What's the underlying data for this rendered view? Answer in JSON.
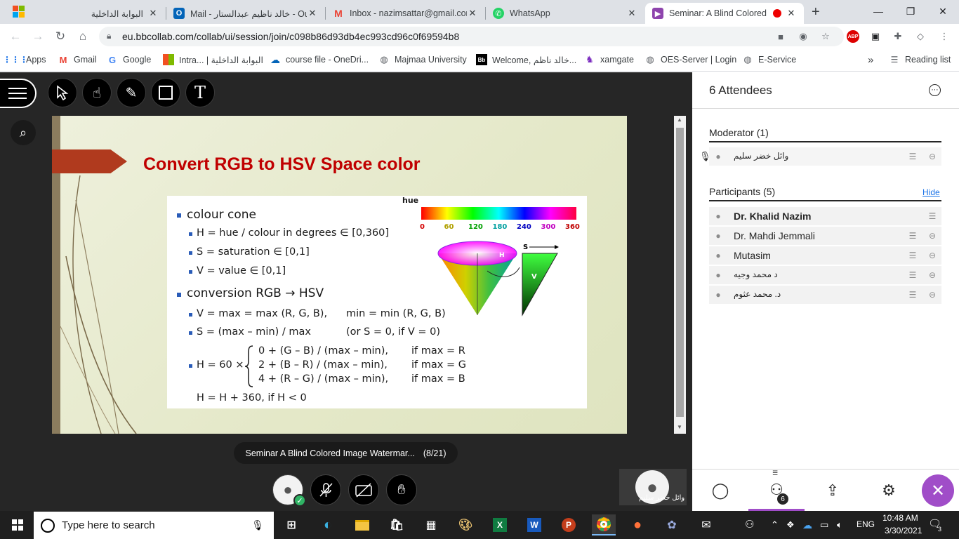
{
  "browser": {
    "tabs": [
      {
        "title": "البوابة الداخلية",
        "icon": "microsoft-icon"
      },
      {
        "title": "Mail - خالد ناظيم عبدالستار - Ou",
        "icon": "outlook-icon"
      },
      {
        "title": "Inbox - nazimsattar@gmail.com",
        "icon": "gmail-icon"
      },
      {
        "title": "WhatsApp",
        "icon": "whatsapp-icon"
      },
      {
        "title": "Seminar: A Blind Colored I",
        "icon": "collab-icon"
      }
    ],
    "url": "eu.bbcollab.com/collab/ui/session/join/c098b86d93db4ec993cd96c0f69594b8",
    "bookmarks": [
      {
        "label": "Apps",
        "icon": "apps-icon"
      },
      {
        "label": "Gmail",
        "icon": "gmail-icon"
      },
      {
        "label": "Google",
        "icon": "google-icon"
      },
      {
        "label": "Intra... | البوابة الداخلية",
        "icon": "microsoft-icon"
      },
      {
        "label": "course file - OneDri...",
        "icon": "onedrive-icon"
      },
      {
        "label": "Majmaa University",
        "icon": "globe-icon"
      },
      {
        "label": "Welcome, خالد ناظم...",
        "icon": "blackboard-icon"
      },
      {
        "label": "xamgate",
        "icon": "xamgate-icon"
      },
      {
        "label": "OES-Server | Login",
        "icon": "globe-icon"
      },
      {
        "label": "E-Service",
        "icon": "globe-icon"
      }
    ],
    "reading_list": "Reading list",
    "more_bookmarks": "»",
    "abp_label": "ABP"
  },
  "slide": {
    "title": "Convert RGB to HSV Space color",
    "hue_label": "hue",
    "hue_ticks": [
      "0",
      "60",
      "120",
      "180",
      "240",
      "300",
      "360"
    ],
    "hue_tick_colors": [
      "#d40000",
      "#b0a000",
      "#00a000",
      "#00a0a0",
      "#0000c0",
      "#c000c0",
      "#c00000"
    ],
    "cone_labels": {
      "h": "H",
      "s": "S",
      "v": "V"
    },
    "bullets": {
      "cone": "colour cone",
      "h": "H = hue / colour in degrees ∈ [0,360]",
      "s": "S = saturation ∈ [0,1]",
      "v": "V = value ∈ [0,1]",
      "conversion": "conversion RGB → HSV",
      "vmax": "V = max = max (R, G, B),",
      "vmin": "min = min (R, G, B)",
      "smax": "S = (max – min) / max",
      "sor": "(or  S = 0,  if  V = 0)",
      "hpre": "H = 60 ×",
      "hcase1": "0 + (G – B) / (max – min),",
      "hcase2": "2 + (B – R) / (max – min),",
      "hcase3": "4 + (R – G) / (max – min),",
      "hcond1": "if  max = R",
      "hcond2": "if  max = G",
      "hcond3": "if  max = B",
      "hfix": "H = H + 360,  if  H < 0"
    }
  },
  "caption": {
    "title": "Seminar A Blind Colored Image Watermar...",
    "page": "(8/21)"
  },
  "speaker": {
    "name": "وائل خضر سليم"
  },
  "panel": {
    "title": "6 Attendees",
    "moderator_heading": "Moderator (1)",
    "moderator": "وائل خضر سليم",
    "participants_heading": "Participants (5)",
    "hide_label": "Hide",
    "participants": [
      "Dr. Khalid Nazim",
      "Dr. Mahdi Jemmali",
      "Mutasim",
      "د محمد وجيه",
      "د. محمد عثوم"
    ],
    "attendee_badge": "6"
  },
  "taskbar": {
    "search_placeholder": "Type here to search",
    "lang": "ENG",
    "time": "10:48 AM",
    "date": "3/30/2021",
    "notif_count": "3"
  },
  "colors": {
    "slide_title": "#c00000",
    "accent_purple": "#a04dc8",
    "hide_link": "#1a73e8"
  }
}
